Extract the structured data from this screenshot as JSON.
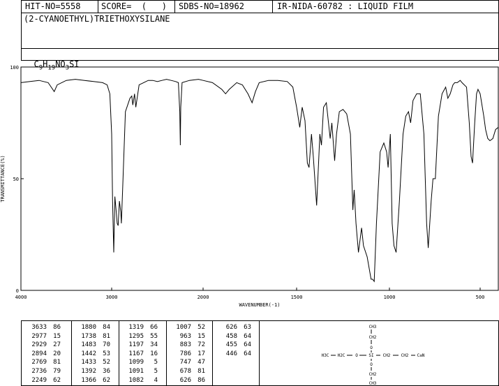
{
  "header": {
    "hit_no": "HIT-NO=5558",
    "score": "SCORE=  (   )",
    "sdbs_no": "SDBS-NO=18962",
    "ir_nida": "IR-NIDA-60782 : LIQUID FILM",
    "compound": "(2-CYANOETHYL)TRIETHOXYSILANE",
    "formula_parts": [
      "C",
      "9",
      "H",
      "19",
      "NO",
      "3",
      "SI"
    ]
  },
  "chart_data": {
    "type": "line",
    "title": "",
    "xlabel": "WAVENUMBER(-1)",
    "ylabel": "TRANSMITTANCE(%)",
    "xlim": [
      4000,
      400
    ],
    "ylim": [
      0,
      100
    ],
    "x_ticks": [
      "4000",
      "3000",
      "2000",
      "1500",
      "1000",
      "500"
    ],
    "x_tick_values": [
      4000,
      3000,
      2000,
      1500,
      1000,
      500
    ],
    "y_ticks": [
      "0",
      "50",
      "100"
    ],
    "y_tick_values": [
      0,
      50,
      100
    ],
    "series": [
      {
        "points": [
          [
            4000,
            93
          ],
          [
            3900,
            93.5
          ],
          [
            3800,
            94
          ],
          [
            3700,
            93
          ],
          [
            3633,
            89
          ],
          [
            3600,
            92
          ],
          [
            3500,
            94
          ],
          [
            3400,
            94.5
          ],
          [
            3300,
            94
          ],
          [
            3200,
            93.5
          ],
          [
            3100,
            93
          ],
          [
            3050,
            92
          ],
          [
            3020,
            88
          ],
          [
            3000,
            70
          ],
          [
            2990,
            40
          ],
          [
            2977,
            17
          ],
          [
            2965,
            42
          ],
          [
            2950,
            35
          ],
          [
            2940,
            30
          ],
          [
            2929,
            29
          ],
          [
            2915,
            40
          ],
          [
            2900,
            35
          ],
          [
            2894,
            30
          ],
          [
            2880,
            45
          ],
          [
            2850,
            80
          ],
          [
            2800,
            86
          ],
          [
            2780,
            87
          ],
          [
            2769,
            83
          ],
          [
            2750,
            88
          ],
          [
            2736,
            82
          ],
          [
            2700,
            92
          ],
          [
            2650,
            93
          ],
          [
            2600,
            94
          ],
          [
            2550,
            94
          ],
          [
            2500,
            93.5
          ],
          [
            2450,
            94
          ],
          [
            2400,
            94.5
          ],
          [
            2350,
            94
          ],
          [
            2300,
            93.5
          ],
          [
            2270,
            93
          ],
          [
            2255,
            80
          ],
          [
            2249,
            65
          ],
          [
            2244,
            82
          ],
          [
            2230,
            93
          ],
          [
            2150,
            94
          ],
          [
            2050,
            94.5
          ],
          [
            2000,
            94
          ],
          [
            1950,
            93
          ],
          [
            1900,
            90
          ],
          [
            1880,
            88
          ],
          [
            1860,
            90
          ],
          [
            1820,
            93
          ],
          [
            1790,
            92
          ],
          [
            1760,
            88
          ],
          [
            1738,
            84
          ],
          [
            1720,
            89
          ],
          [
            1700,
            93
          ],
          [
            1650,
            94
          ],
          [
            1600,
            94
          ],
          [
            1550,
            93.5
          ],
          [
            1520,
            91
          ],
          [
            1500,
            82
          ],
          [
            1483,
            73
          ],
          [
            1470,
            82
          ],
          [
            1455,
            76
          ],
          [
            1442,
            57
          ],
          [
            1433,
            55
          ],
          [
            1420,
            70
          ],
          [
            1410,
            60
          ],
          [
            1392,
            38
          ],
          [
            1380,
            60
          ],
          [
            1375,
            70
          ],
          [
            1366,
            65
          ],
          [
            1355,
            82
          ],
          [
            1340,
            84
          ],
          [
            1319,
            68
          ],
          [
            1310,
            75
          ],
          [
            1295,
            58
          ],
          [
            1285,
            70
          ],
          [
            1270,
            80
          ],
          [
            1250,
            81
          ],
          [
            1230,
            79
          ],
          [
            1210,
            70
          ],
          [
            1197,
            36
          ],
          [
            1190,
            45
          ],
          [
            1180,
            30
          ],
          [
            1167,
            17
          ],
          [
            1150,
            28
          ],
          [
            1140,
            20
          ],
          [
            1120,
            15
          ],
          [
            1099,
            5
          ],
          [
            1091,
            5
          ],
          [
            1082,
            4
          ],
          [
            1070,
            30
          ],
          [
            1050,
            62
          ],
          [
            1030,
            66
          ],
          [
            1015,
            62
          ],
          [
            1007,
            55
          ],
          [
            995,
            70
          ],
          [
            985,
            30
          ],
          [
            975,
            20
          ],
          [
            963,
            17
          ],
          [
            945,
            40
          ],
          [
            925,
            70
          ],
          [
            910,
            78
          ],
          [
            895,
            80
          ],
          [
            883,
            75
          ],
          [
            870,
            85
          ],
          [
            850,
            88
          ],
          [
            830,
            88
          ],
          [
            810,
            70
          ],
          [
            795,
            30
          ],
          [
            786,
            19
          ],
          [
            770,
            40
          ],
          [
            760,
            50
          ],
          [
            747,
            50
          ],
          [
            730,
            78
          ],
          [
            710,
            88
          ],
          [
            690,
            91
          ],
          [
            678,
            86
          ],
          [
            665,
            88
          ],
          [
            650,
            92
          ],
          [
            640,
            93
          ],
          [
            626,
            93
          ],
          [
            610,
            94
          ],
          [
            600,
            93
          ],
          [
            575,
            91
          ],
          [
            560,
            75
          ],
          [
            550,
            60
          ],
          [
            542,
            57
          ],
          [
            530,
            75
          ],
          [
            520,
            88
          ],
          [
            512,
            90
          ],
          [
            500,
            88
          ],
          [
            480,
            78
          ],
          [
            470,
            72
          ],
          [
            458,
            68
          ],
          [
            446,
            67
          ],
          [
            430,
            68
          ],
          [
            415,
            72
          ],
          [
            400,
            73
          ]
        ]
      }
    ],
    "grid": false
  },
  "peak_table": {
    "columns": [
      [
        [
          "3633",
          "86"
        ],
        [
          "2977",
          "15"
        ],
        [
          "2929",
          "27"
        ],
        [
          "2894",
          "20"
        ],
        [
          "2769",
          "81"
        ],
        [
          "2736",
          "79"
        ],
        [
          "2249",
          "62"
        ]
      ],
      [
        [
          "1880",
          "84"
        ],
        [
          "1738",
          "81"
        ],
        [
          "1483",
          "70"
        ],
        [
          "1442",
          "53"
        ],
        [
          "1433",
          "52"
        ],
        [
          "1392",
          "36"
        ],
        [
          "1366",
          "62"
        ]
      ],
      [
        [
          "1319",
          "66"
        ],
        [
          "1295",
          "55"
        ],
        [
          "1197",
          "34"
        ],
        [
          "1167",
          "16"
        ],
        [
          "1099",
          "5"
        ],
        [
          "1091",
          "5"
        ],
        [
          "1082",
          "4"
        ]
      ],
      [
        [
          "1007",
          "52"
        ],
        [
          "963",
          "15"
        ],
        [
          "883",
          "72"
        ],
        [
          "786",
          "17"
        ],
        [
          "747",
          "47"
        ],
        [
          "678",
          "81"
        ],
        [
          "626",
          "86"
        ]
      ],
      [
        [
          "626",
          "63"
        ],
        [
          "458",
          "64"
        ],
        [
          "455",
          "64"
        ],
        [
          "446",
          "64"
        ]
      ]
    ]
  },
  "structure": {
    "labels": [
      "CH3",
      "CH2",
      "O",
      "H3C",
      "H2C",
      "O",
      "SI",
      "CH2",
      "CH2",
      "C≡N",
      "O",
      "CH2",
      "CH3"
    ]
  }
}
